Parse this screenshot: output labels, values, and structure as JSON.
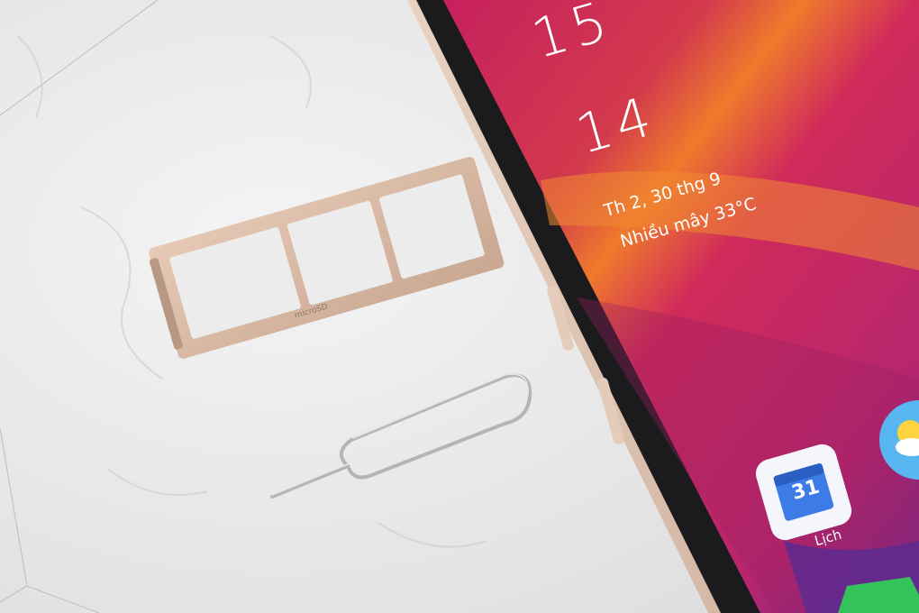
{
  "lock_screen": {
    "hour": "15",
    "minute": "14",
    "date": "Th 2, 30 thg 9",
    "weather": "Nhiều mây 33°C"
  },
  "apps": {
    "calendar_label": "Lịch",
    "calendar_day": "31"
  },
  "sim_tray": {
    "slot_label": "microSD"
  },
  "colors": {
    "wallpaper_top": "#c4205c",
    "wallpaper_orange": "#f07a2a",
    "wallpaper_purple": "#6a2a8e",
    "tray_gold": "#d8b9a2",
    "phone_frame": "#dcc0ad",
    "marble": "#e9e9ea"
  }
}
